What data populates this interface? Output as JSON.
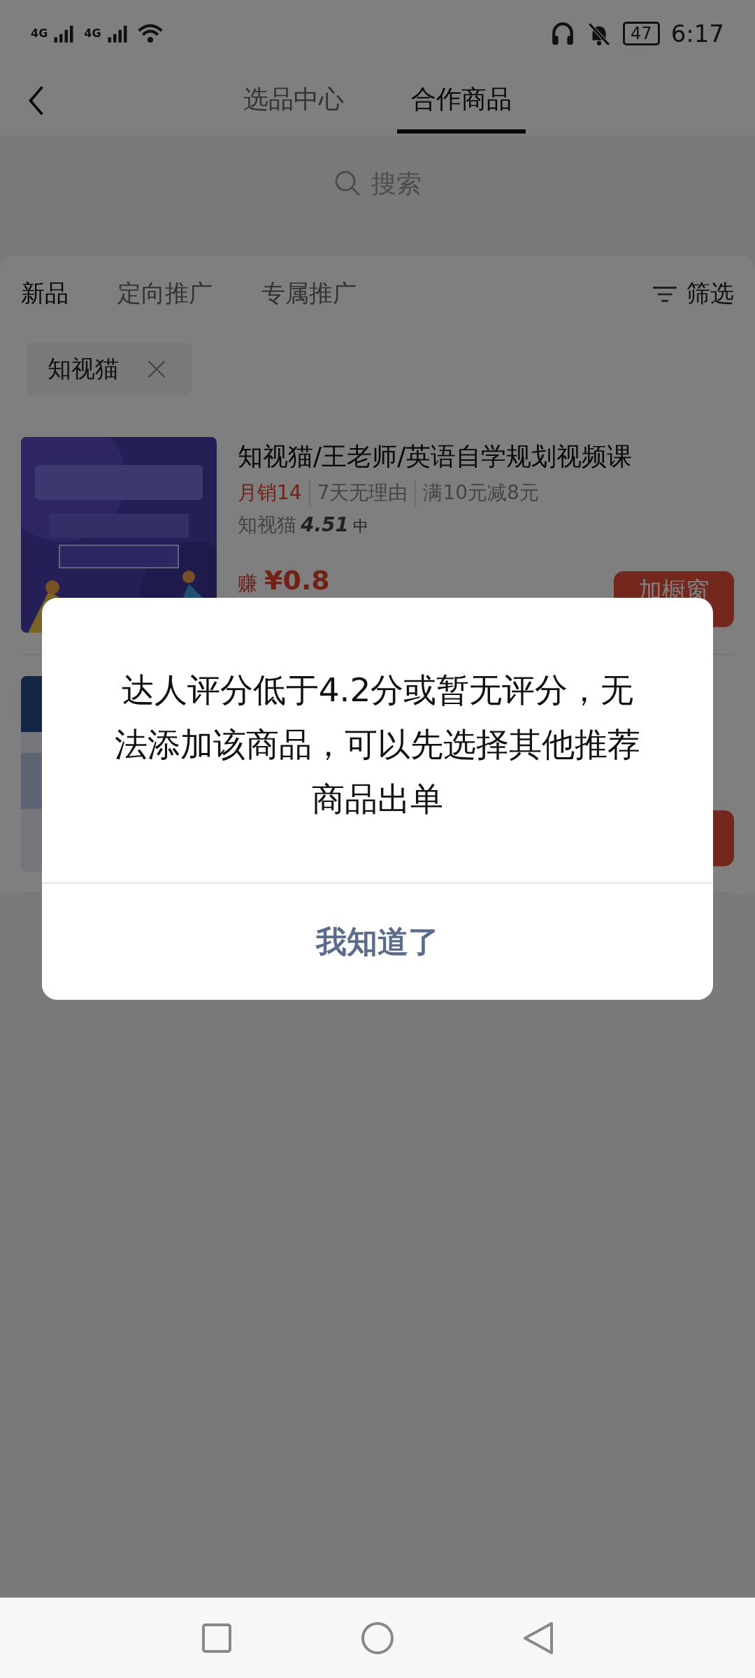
{
  "status_bar": {
    "network": [
      "4G",
      "4G"
    ],
    "battery": "47",
    "time": "6:17"
  },
  "header": {
    "tabs": [
      {
        "label": "选品中心",
        "selected": false
      },
      {
        "label": "合作商品",
        "selected": true
      }
    ]
  },
  "search": {
    "placeholder": "搜索"
  },
  "filter_tabs": [
    {
      "label": "新品",
      "selected": true
    },
    {
      "label": "定向推广",
      "selected": false
    },
    {
      "label": "专属推广",
      "selected": false
    }
  ],
  "filter_button": "筛选",
  "chips": [
    {
      "label": "知视猫"
    }
  ],
  "products": [
    {
      "kind": "full",
      "title": "知视猫/王老师/英语自学规划视频课",
      "sales": "月销14",
      "tags": [
        "7天无理由",
        "满10元减8元"
      ],
      "shop": "知视猫",
      "score": "4.51",
      "score_level": "中",
      "earn_label": "赚",
      "earn": "¥0.8",
      "button": "加橱窗"
    },
    {
      "kind": "hidden"
    }
  ],
  "dialog": {
    "message": "达人评分低于4.2分或暂无评分，无法添加该商品，可以先选择其他推荐商品出单",
    "button": "我知道了"
  }
}
